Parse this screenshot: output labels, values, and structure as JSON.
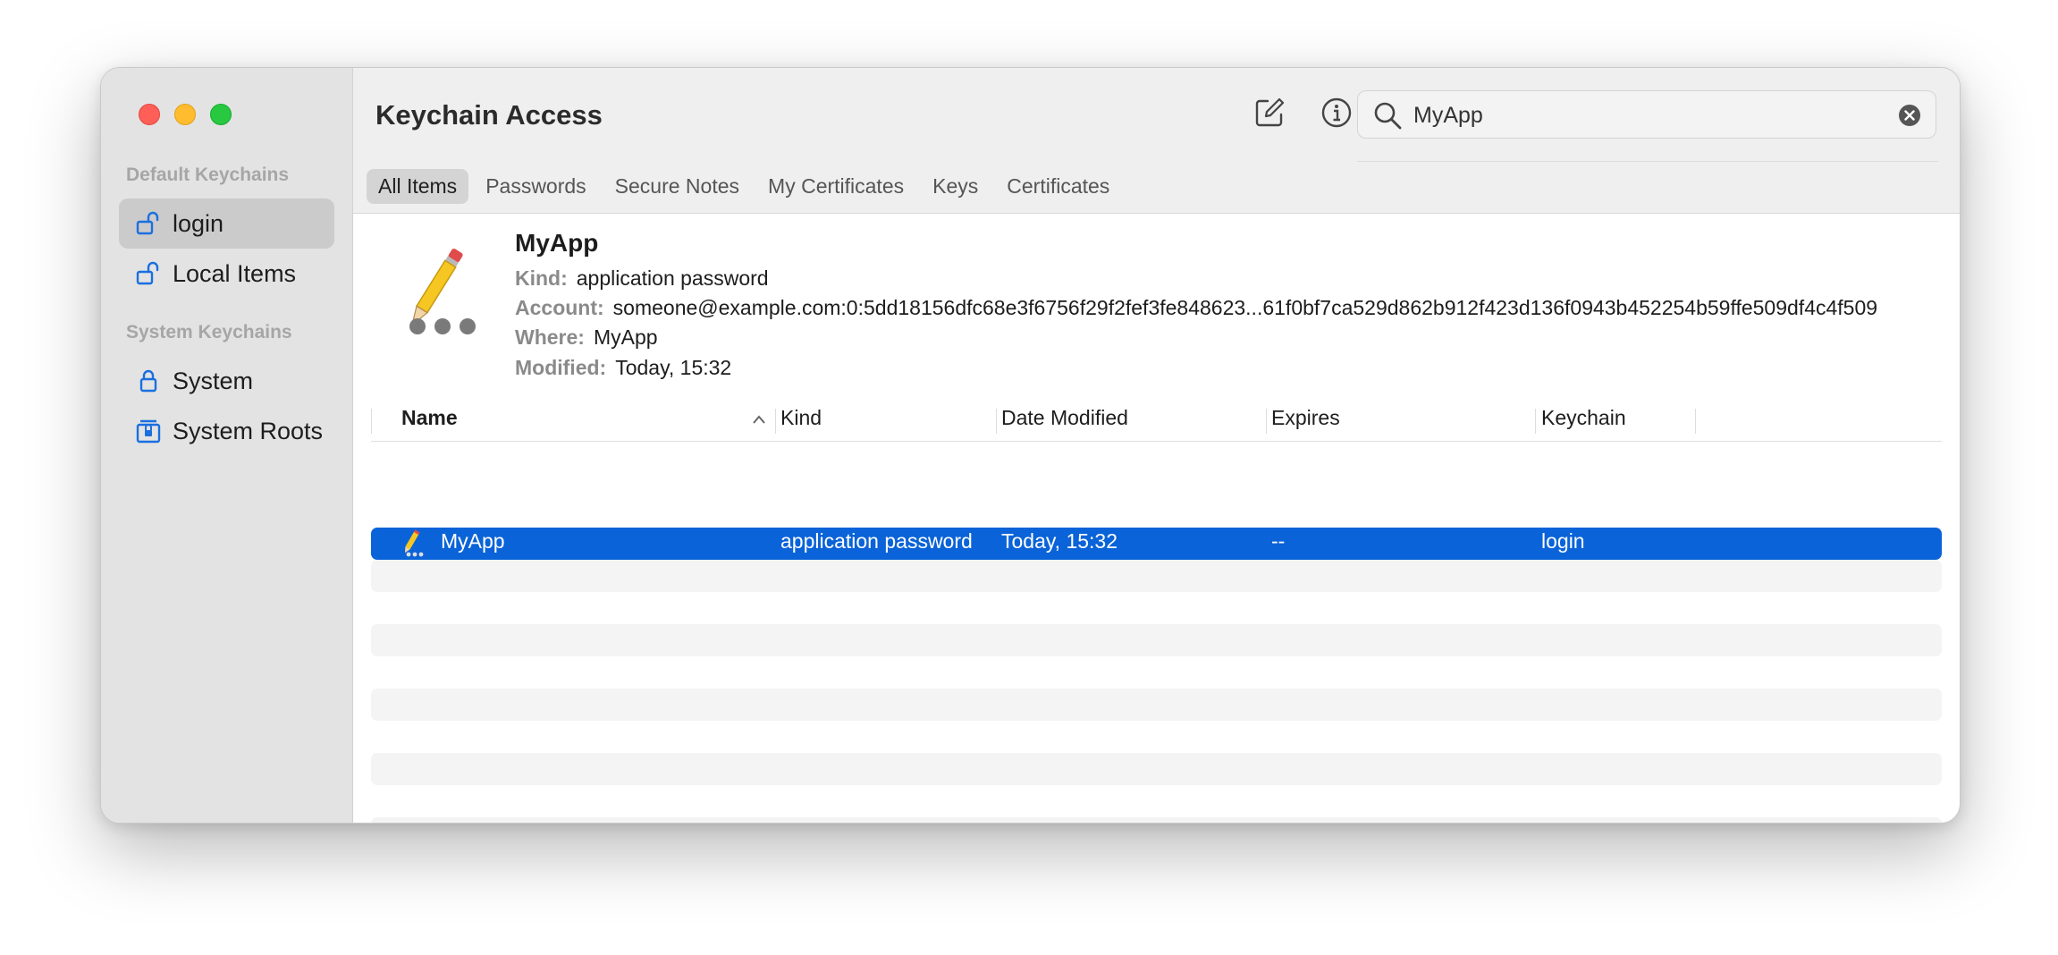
{
  "sidebar": {
    "default_section": "Default Keychains",
    "system_section": "System Keychains",
    "items": [
      {
        "label": "login",
        "icon": "unlocked-padlock-icon",
        "selected": true
      },
      {
        "label": "Local Items",
        "icon": "unlocked-padlock-icon",
        "selected": false
      },
      {
        "label": "System",
        "icon": "locked-padlock-icon",
        "selected": false
      },
      {
        "label": "System Roots",
        "icon": "locked-cabinet-icon",
        "selected": false
      }
    ]
  },
  "toolbar": {
    "title": "Keychain Access",
    "compose_icon": "compose-icon",
    "info_icon": "info-icon",
    "search": {
      "value": "MyApp",
      "placeholder": "Search"
    }
  },
  "tabs": [
    "All Items",
    "Passwords",
    "Secure Notes",
    "My Certificates",
    "Keys",
    "Certificates"
  ],
  "active_tab": "All Items",
  "detail": {
    "name": "MyApp",
    "kind_label": "Kind:",
    "kind": "application password",
    "account_label": "Account:",
    "account": "someone@example.com:0:5dd18156dfc68e3f6756f29f2fef3fe848623...61f0bf7ca529d862b912f423d136f0943b452254b59ffe509df4c4f509",
    "where_label": "Where:",
    "where": "MyApp",
    "modified_label": "Modified:",
    "modified": "Today, 15:32"
  },
  "table": {
    "columns": [
      "Name",
      "Kind",
      "Date Modified",
      "Expires",
      "Keychain"
    ],
    "rows": [
      {
        "name": "MyApp",
        "kind": "application password",
        "date_modified": "Today, 15:32",
        "expires": "--",
        "keychain": "login"
      }
    ]
  },
  "colors": {
    "accent": "#0a63d8",
    "close": "#ff5f57",
    "minimize": "#febc2e",
    "maximize": "#28c840"
  }
}
